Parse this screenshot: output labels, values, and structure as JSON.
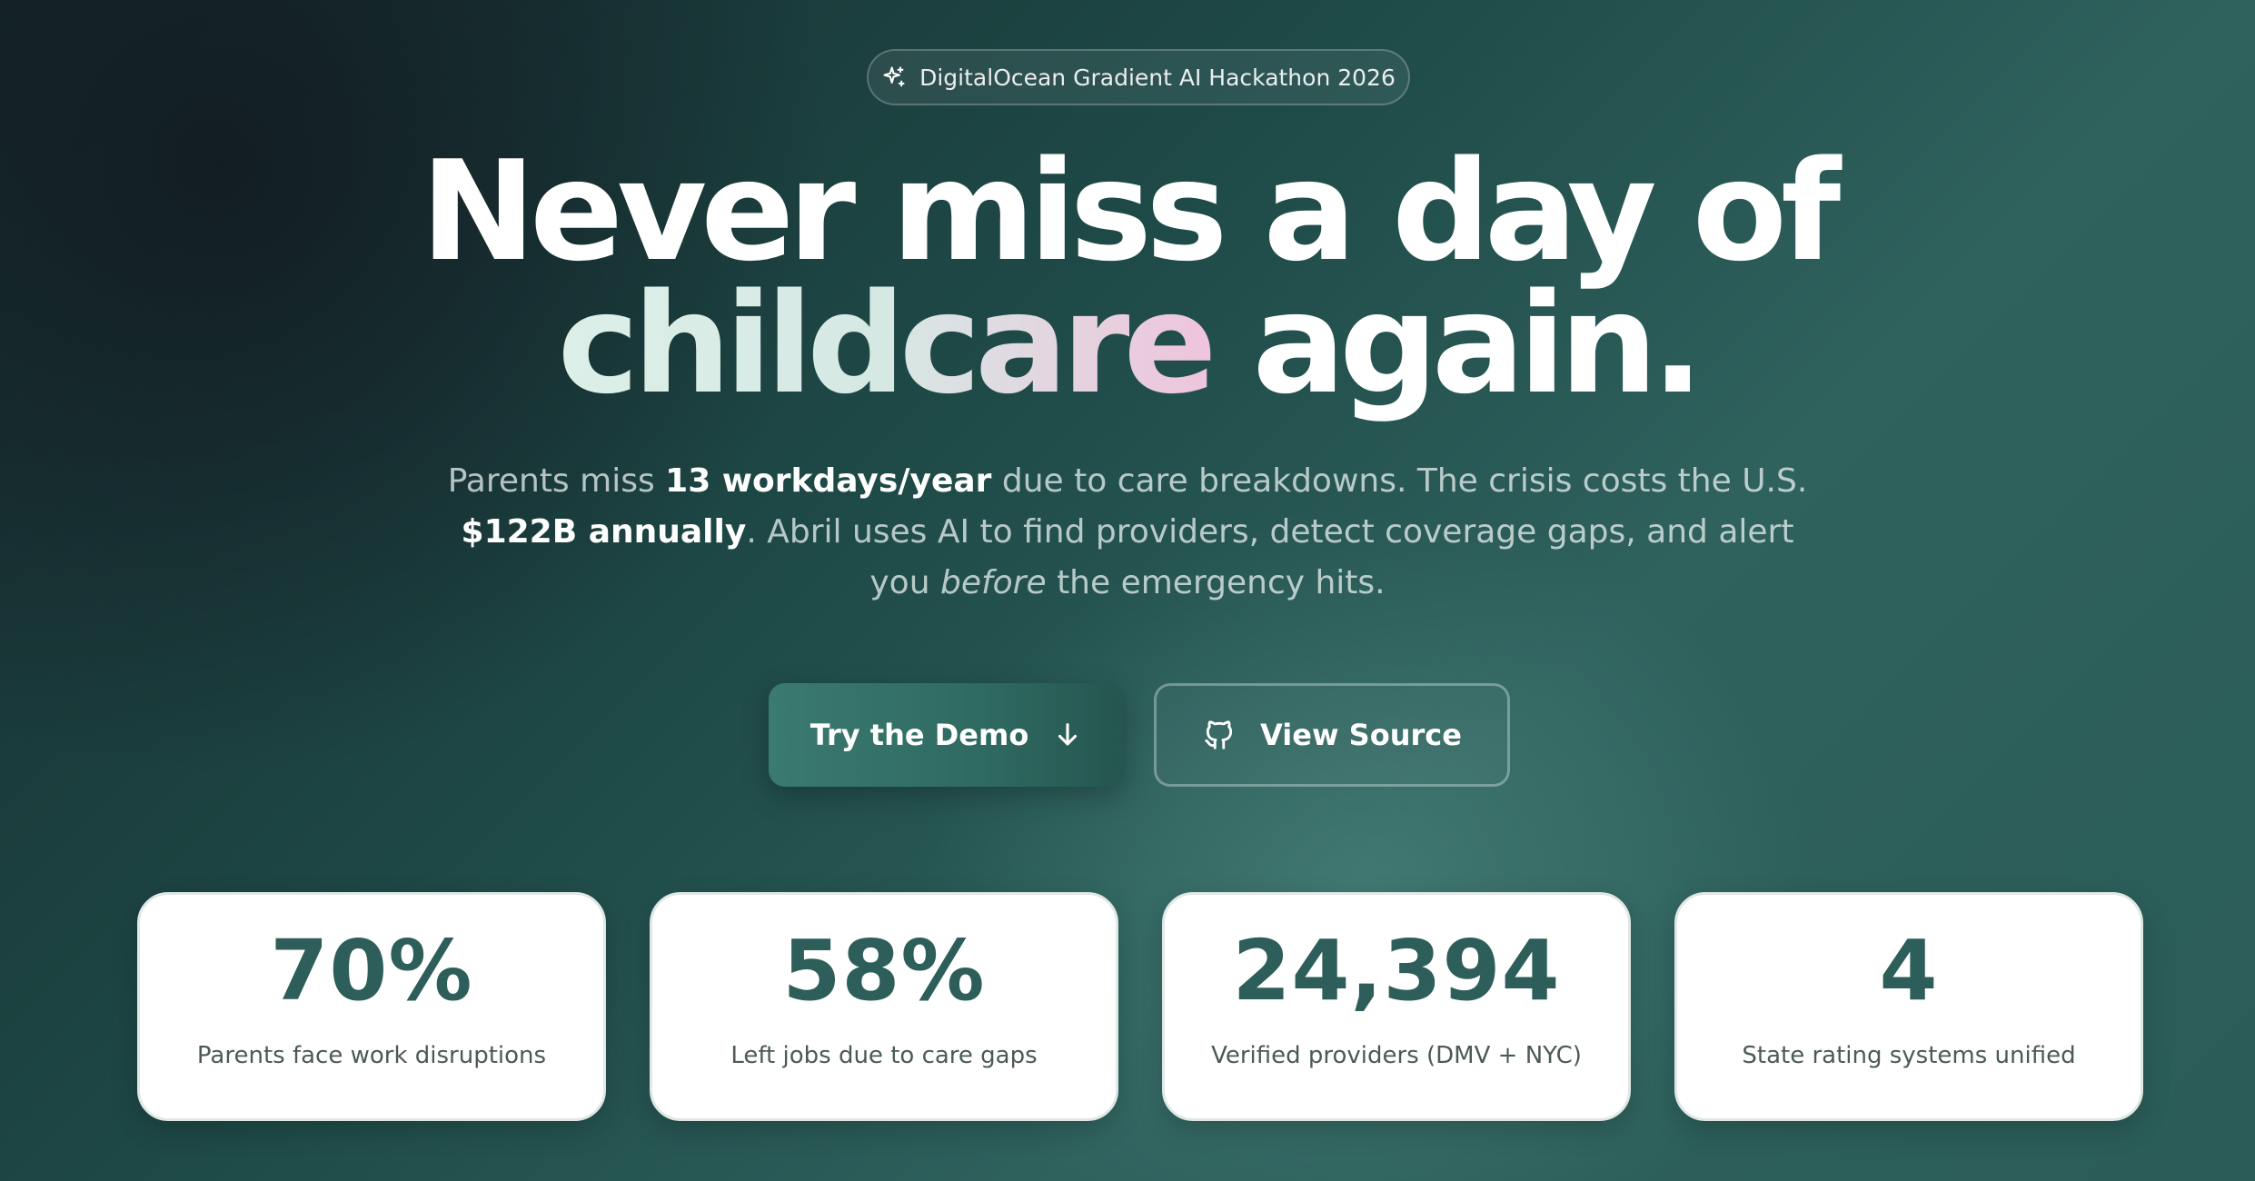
{
  "badge": {
    "icon": "sparkle-icon",
    "label": "DigitalOcean Gradient AI Hackathon 2026"
  },
  "headline": {
    "line1": "Never miss a day of",
    "highlight": "childcare",
    "line2_rest": " again."
  },
  "description": {
    "t1": "Parents miss ",
    "b1": "13 workdays/year",
    "t2": " due to care breakdowns. The crisis costs the U.S. ",
    "b2": "$122B annually",
    "t3": ". Abril uses AI to find providers, detect coverage gaps, and alert you ",
    "i1": "before",
    "t4": " the emergency hits."
  },
  "buttons": {
    "demo": {
      "label": "Try the Demo",
      "icon": "arrow-down-icon"
    },
    "source": {
      "label": "View Source",
      "icon": "github-icon"
    }
  },
  "stats": [
    {
      "value": "70%",
      "label": "Parents face work disruptions"
    },
    {
      "value": "58%",
      "label": "Left jobs due to care gaps"
    },
    {
      "value": "24,394",
      "label": "Verified providers (DMV + NYC)"
    },
    {
      "value": "4",
      "label": "State rating systems unified"
    }
  ],
  "colors": {
    "accent": "#2d5e59",
    "background_dark": "#162a2d",
    "background_teal": "#2f615d",
    "highlight_gradient_start": "#dcefe8",
    "highlight_gradient_end": "#efc4dc"
  }
}
